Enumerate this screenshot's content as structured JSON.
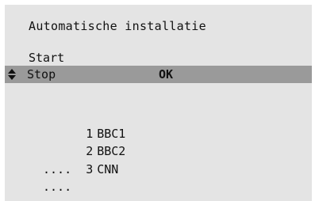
{
  "title": "Automatische installatie",
  "menu": {
    "start_label": "Start",
    "stop_label": "Stop",
    "ok_label": "OK"
  },
  "channels": [
    {
      "number": "1",
      "name": "BBC1"
    },
    {
      "number": "2",
      "name": "BBC2"
    },
    {
      "number": "3",
      "name": "CNN"
    }
  ],
  "ellipsis": [
    "....",
    "...."
  ],
  "icons": {
    "selector": "up-down-arrow-icon"
  },
  "colors": {
    "background": "#e4e4e4",
    "highlight": "#9a9a9a",
    "text": "#111111"
  }
}
